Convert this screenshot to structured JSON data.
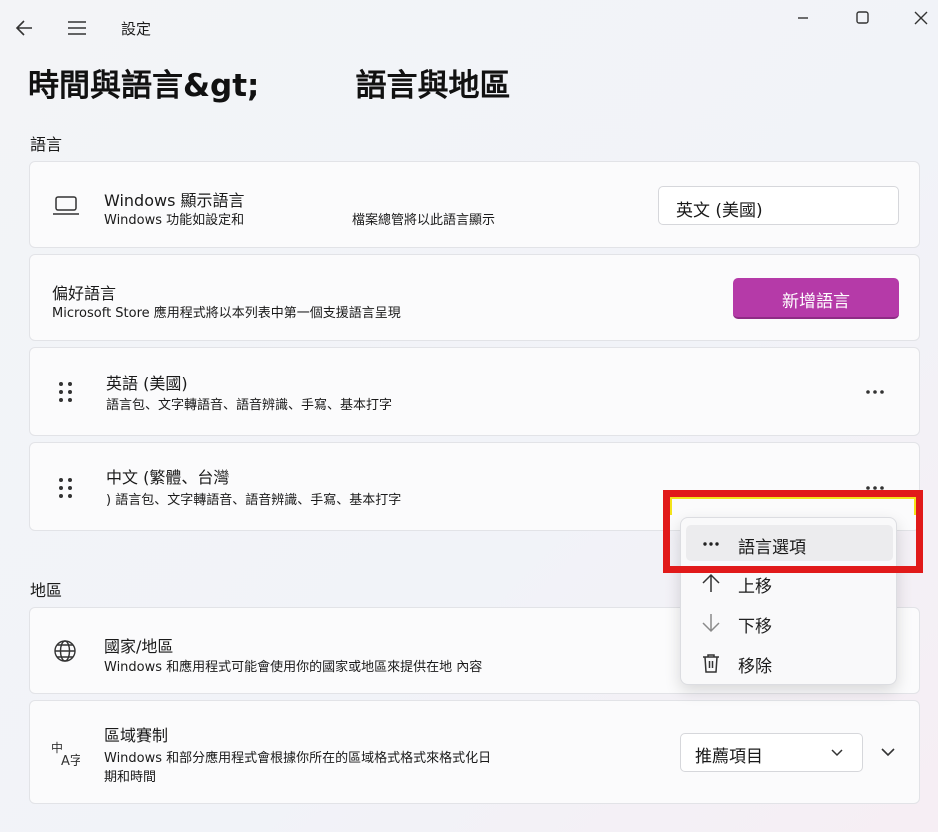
{
  "app": {
    "title": "設定"
  },
  "page": {
    "title_left": "時間與語言&gt;",
    "title_right": "語言與地區"
  },
  "language_section": {
    "label": "語言",
    "display_language": {
      "title": "Windows 顯示語言",
      "subtitle_a": "Windows 功能如設定和",
      "subtitle_b": "檔案總管將以此語言顯示",
      "value": "英文 (美國)"
    },
    "preferred": {
      "title": "偏好語言",
      "subtitle": "Microsoft Store 應用程式將以本列表中第一個支援語言呈現",
      "add_button": "新增語言"
    },
    "languages": [
      {
        "name": "英語 (美國)",
        "features": "語言包、文字轉語音、語音辨識、手寫、基本打字"
      },
      {
        "name": "中文 (繁體、台灣",
        "features": ") 語言包、文字轉語音、語音辨識、手寫、基本打字"
      }
    ]
  },
  "context_menu": {
    "items": [
      {
        "label": "語言選項",
        "icon": "more-horizontal-icon"
      },
      {
        "label": "上移",
        "icon": "arrow-up-icon"
      },
      {
        "label": "下移",
        "icon": "arrow-down-icon"
      },
      {
        "label": "移除",
        "icon": "trash-icon"
      }
    ]
  },
  "region_section": {
    "label": "地區",
    "country": {
      "title": "國家/地區",
      "subtitle": "Windows 和應用程式可能會使用你的國家或地區來提供在地 內容"
    },
    "format": {
      "title": "區域賽制",
      "subtitle_1": "Windows 和部分應用程式會根據你所在的區域格式格式來格式化日",
      "subtitle_2": "期和時間",
      "value": "推薦項目"
    }
  },
  "colors": {
    "accent": "#b53aa8",
    "highlight": "#e11a1a",
    "highlight_inner": "#f3e41a"
  }
}
